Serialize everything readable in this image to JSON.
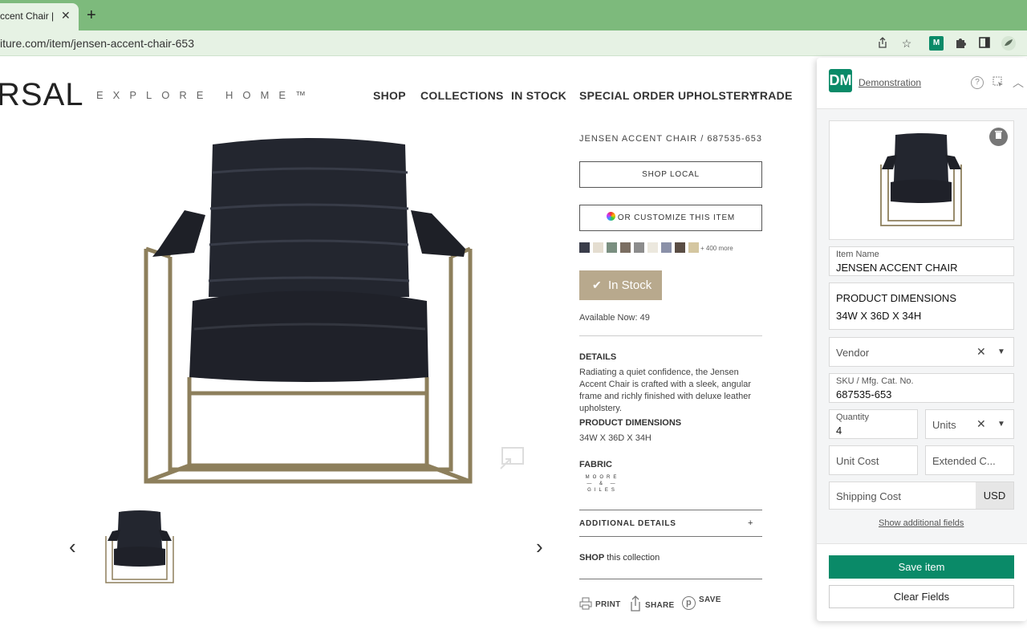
{
  "browser": {
    "tab_title": "ccent Chair |",
    "tab_close_icon": "close-icon",
    "new_tab_icon": "plus-icon",
    "url": "iture.com/item/jensen-accent-chair-653",
    "toolbar_icons": [
      "share-icon",
      "star-icon",
      "extension-dm-icon",
      "puzzle-icon",
      "sidebar-icon",
      "profile-icon"
    ]
  },
  "site": {
    "logo": "RSAL",
    "logo_sub": "EXPLORE HOME™",
    "nav": [
      "SHOP",
      "COLLECTIONS",
      "IN STOCK",
      "SPECIAL ORDER UPHOLSTERY",
      "TRADE"
    ]
  },
  "product": {
    "title": "JENSEN ACCENT CHAIR / 687535-653",
    "shop_local": "SHOP LOCAL",
    "customize": "OR CUSTOMIZE THIS ITEM",
    "swatches": [
      "#3a3d4a",
      "#e4ddd0",
      "#7a8f80",
      "#7b6e62",
      "#8c8c8c",
      "#ece8de",
      "#8a90a8",
      "#5a4d44",
      "#d4c6a0"
    ],
    "more_swatches": "+ 400 more",
    "stock_label": "In Stock",
    "available": "Available Now: 49",
    "details_heading": "DETAILS",
    "details_text": "Radiating a quiet confidence, the Jensen Accent Chair is crafted with a sleek, angular frame and richly finished with deluxe leather upholstery.",
    "dimensions_heading": "PRODUCT DIMENSIONS",
    "dimensions_value": "34W X 36D X 34H",
    "fabric_heading": "FABRIC",
    "fabric_logo": "MOORE & GILES",
    "additional_details": "ADDITIONAL DETAILS",
    "additional_plus": "+",
    "shop_bold": "SHOP",
    "shop_rest": " this collection",
    "actions": [
      "PRINT",
      "SHARE",
      "SAVE"
    ]
  },
  "panel": {
    "logo_text": "DM",
    "account": "Demonstration",
    "item_name_label": "Item Name",
    "item_name_value": "JENSEN ACCENT CHAIR",
    "dims_title": "PRODUCT DIMENSIONS",
    "dims_value": "34W X 36D X 34H",
    "vendor_placeholder": "Vendor",
    "sku_label": "SKU / Mfg. Cat. No.",
    "sku_value": "687535-653",
    "quantity_label": "Quantity",
    "quantity_value": "4",
    "units_placeholder": "Units",
    "unit_cost_placeholder": "Unit Cost",
    "extended_cost_placeholder": "Extended C...",
    "shipping_placeholder": "Shipping Cost",
    "currency": "USD",
    "show_additional": "Show additional fields",
    "save": "Save item",
    "clear": "Clear Fields"
  }
}
